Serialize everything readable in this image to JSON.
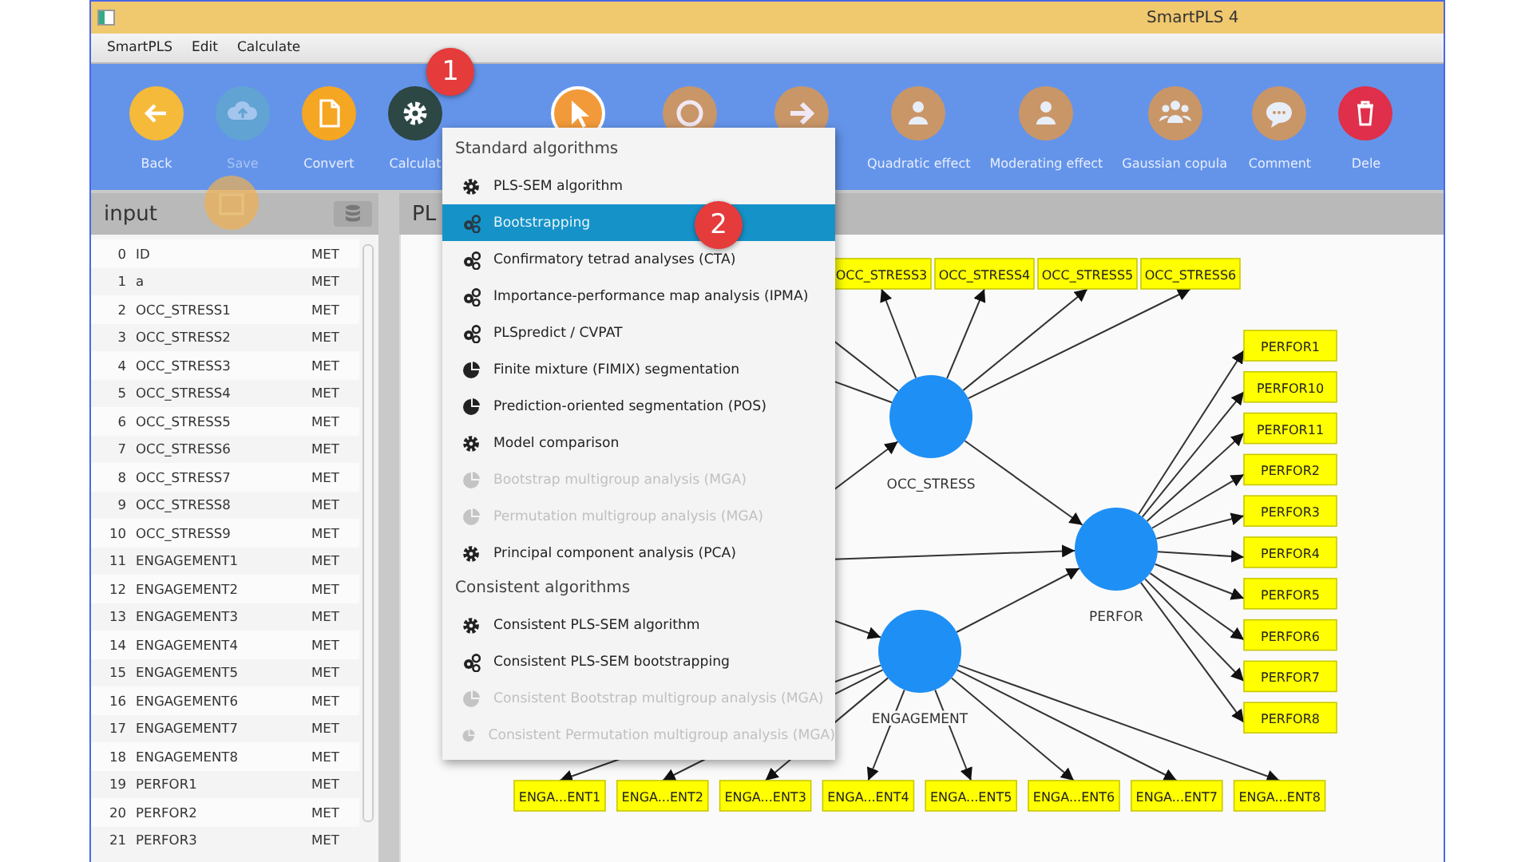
{
  "window": {
    "title": "SmartPLS 4"
  },
  "menu_bar": [
    "SmartPLS",
    "Edit",
    "Calculate"
  ],
  "toolbar": [
    {
      "tools": [
        {
          "kind": "back",
          "label": "Back",
          "disabled": false,
          "selected": false
        },
        {
          "kind": "save",
          "label": "Save",
          "disabled": true,
          "selected": false
        },
        {
          "kind": "convert",
          "label": "Convert",
          "disabled": false,
          "selected": false
        },
        {
          "kind": "calculate",
          "label": "Calculat",
          "disabled": false,
          "selected": false
        }
      ]
    },
    {
      "tools": [
        {
          "kind": "pointer",
          "disabled": false,
          "selected": true
        },
        {
          "kind": "construct",
          "disabled": false,
          "selected": false
        },
        {
          "kind": "connect",
          "disabled": false,
          "selected": false
        },
        {
          "kind": "quadratic",
          "label": "Quadratic effect",
          "disabled": false,
          "selected": false
        },
        {
          "kind": "moderating",
          "label": "Moderating effect",
          "disabled": false,
          "selected": false
        },
        {
          "kind": "copula",
          "label": "Gaussian copula",
          "disabled": false,
          "selected": false
        },
        {
          "kind": "comment",
          "label": "Comment",
          "disabled": false,
          "selected": false
        },
        {
          "kind": "delete",
          "label": "Dele",
          "disabled": false,
          "selected": false
        }
      ]
    }
  ],
  "input_panel": {
    "title": "input",
    "rows": [
      {
        "index": "0",
        "name": "ID",
        "type": "MET"
      },
      {
        "index": "1",
        "name": "a",
        "type": "MET"
      },
      {
        "index": "2",
        "name": "OCC_STRESS1",
        "type": "MET"
      },
      {
        "index": "3",
        "name": "OCC_STRESS2",
        "type": "MET"
      },
      {
        "index": "4",
        "name": "OCC_STRESS3",
        "type": "MET"
      },
      {
        "index": "5",
        "name": "OCC_STRESS4",
        "type": "MET"
      },
      {
        "index": "6",
        "name": "OCC_STRESS5",
        "type": "MET"
      },
      {
        "index": "7",
        "name": "OCC_STRESS6",
        "type": "MET"
      },
      {
        "index": "8",
        "name": "OCC_STRESS7",
        "type": "MET"
      },
      {
        "index": "9",
        "name": "OCC_STRESS8",
        "type": "MET"
      },
      {
        "index": "10",
        "name": "OCC_STRESS9",
        "type": "MET"
      },
      {
        "index": "11",
        "name": "ENGAGEMENT1",
        "type": "MET"
      },
      {
        "index": "12",
        "name": "ENGAGEMENT2",
        "type": "MET"
      },
      {
        "index": "13",
        "name": "ENGAGEMENT3",
        "type": "MET"
      },
      {
        "index": "14",
        "name": "ENGAGEMENT4",
        "type": "MET"
      },
      {
        "index": "15",
        "name": "ENGAGEMENT5",
        "type": "MET"
      },
      {
        "index": "16",
        "name": "ENGAGEMENT6",
        "type": "MET"
      },
      {
        "index": "17",
        "name": "ENGAGEMENT7",
        "type": "MET"
      },
      {
        "index": "18",
        "name": "ENGAGEMENT8",
        "type": "MET"
      },
      {
        "index": "19",
        "name": "PERFOR1",
        "type": "MET"
      },
      {
        "index": "20",
        "name": "PERFOR2",
        "type": "MET"
      },
      {
        "index": "21",
        "name": "PERFOR3",
        "type": "MET"
      }
    ]
  },
  "model_tab": {
    "title": "PL"
  },
  "model": {
    "constructs": [
      {
        "name": "OCC_STRESS",
        "indicators": [
          "OCC_STRESS3",
          "OCC_STRESS4",
          "OCC_STRESS5",
          "OCC_STRESS6"
        ]
      },
      {
        "name": "PERFOR",
        "indicators": [
          "PERFOR1",
          "PERFOR10",
          "PERFOR11",
          "PERFOR2",
          "PERFOR3",
          "PERFOR4",
          "PERFOR5",
          "PERFOR6",
          "PERFOR7",
          "PERFOR8"
        ]
      },
      {
        "name": "ENGAGEMENT",
        "indicators": [
          "ENGA...ENT1",
          "ENGA...ENT2",
          "ENGA...ENT3",
          "ENGA...ENT4",
          "ENGA...ENT5",
          "ENGA...ENT6",
          "ENGA...ENT7",
          "ENGA...ENT8"
        ]
      }
    ]
  },
  "calculate_menu": {
    "sections": [
      {
        "title": "Standard algorithms",
        "items": [
          {
            "kind": "gear",
            "label": "PLS-SEM algorithm",
            "disabled": false,
            "selected": false
          },
          {
            "kind": "gears",
            "label": "Bootstrapping",
            "disabled": false,
            "selected": true
          },
          {
            "kind": "gears",
            "label": "Confirmatory tetrad analyses (CTA)",
            "disabled": false,
            "selected": false
          },
          {
            "kind": "gears",
            "label": "Importance-performance map analysis (IPMA)",
            "disabled": false,
            "selected": false
          },
          {
            "kind": "gears",
            "label": "PLSpredict / CVPAT",
            "disabled": false,
            "selected": false
          },
          {
            "kind": "pie",
            "label": "Finite mixture (FIMIX) segmentation",
            "disabled": false,
            "selected": false
          },
          {
            "kind": "pie",
            "label": "Prediction-oriented segmentation (POS)",
            "disabled": false,
            "selected": false
          },
          {
            "kind": "gear",
            "label": "Model comparison",
            "disabled": false,
            "selected": false
          },
          {
            "kind": "pie",
            "label": "Bootstrap multigroup analysis (MGA)",
            "disabled": true,
            "selected": false
          },
          {
            "kind": "pie",
            "label": "Permutation multigroup analysis (MGA)",
            "disabled": true,
            "selected": false
          },
          {
            "kind": "gear",
            "label": "Principal component analysis (PCA)",
            "disabled": false,
            "selected": false
          }
        ]
      },
      {
        "title": "Consistent algorithms",
        "items": [
          {
            "kind": "gear",
            "label": "Consistent PLS-SEM algorithm",
            "disabled": false,
            "selected": false
          },
          {
            "kind": "gears",
            "label": "Consistent PLS-SEM bootstrapping",
            "disabled": false,
            "selected": false
          },
          {
            "kind": "pie",
            "label": "Consistent Bootstrap multigroup analysis (MGA)",
            "disabled": true,
            "selected": false
          },
          {
            "kind": "pie",
            "label": "Consistent Permutation multigroup analysis (MGA)",
            "disabled": true,
            "selected": false
          }
        ]
      }
    ]
  },
  "step_badges": [
    "1",
    "2"
  ]
}
